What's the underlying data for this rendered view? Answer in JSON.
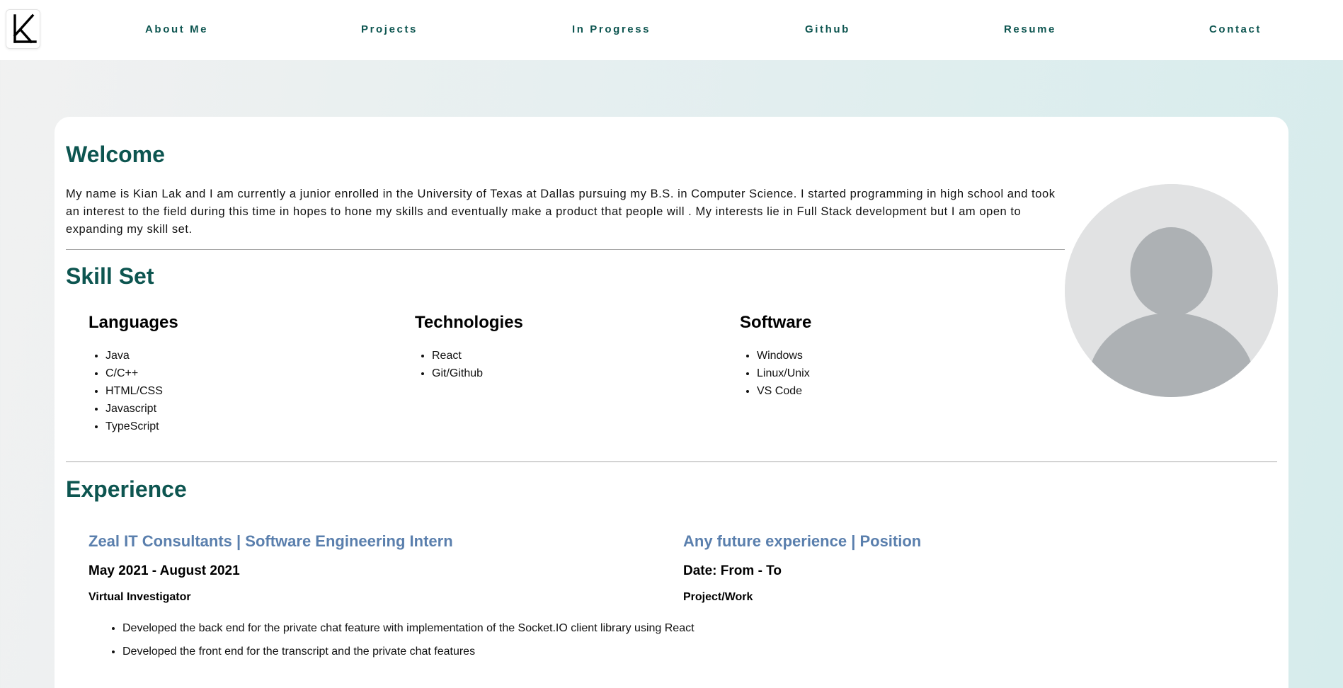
{
  "nav": {
    "logo_letter": "K",
    "links": [
      "About Me",
      "Projects",
      "In Progress",
      "Github",
      "Resume",
      "Contact"
    ]
  },
  "welcome": {
    "heading": "Welcome",
    "text": "My name is Kian Lak and I am currently a junior enrolled in the University of Texas at Dallas pursuing my B.S. in Computer Science. I started programming in high school and took an interest to the field during this time in hopes to hone my skills and eventually make a product that people will . My interests lie in Full Stack development but I am open to expanding my skill set."
  },
  "skills": {
    "heading": "Skill Set",
    "columns": [
      {
        "title": "Languages",
        "items": [
          "Java",
          "C/C++",
          "HTML/CSS",
          "Javascript",
          "TypeScript"
        ]
      },
      {
        "title": "Technologies",
        "items": [
          "React",
          "Git/Github"
        ]
      },
      {
        "title": "Software",
        "items": [
          "Windows",
          "Linux/Unix",
          "VS Code"
        ]
      }
    ]
  },
  "experience": {
    "heading": "Experience",
    "entries": [
      {
        "title": "Zeal IT Consultants | Software Engineering Intern",
        "date": "May 2021 - August 2021",
        "project": "Virtual Investigator",
        "bullets": [
          "Developed the back end for the private chat feature with implementation of the Socket.IO client library using React",
          "Developed the front end for the transcript and the private chat features"
        ]
      },
      {
        "title": "Any future experience | Position",
        "date": "Date: From - To",
        "project": "Project/Work",
        "bullets": []
      }
    ]
  },
  "colors": {
    "accent": "#0d5550",
    "experience_title": "#5a7fad",
    "avatar_bg": "#e1e2e3",
    "avatar_fg": "#adb1b4"
  }
}
